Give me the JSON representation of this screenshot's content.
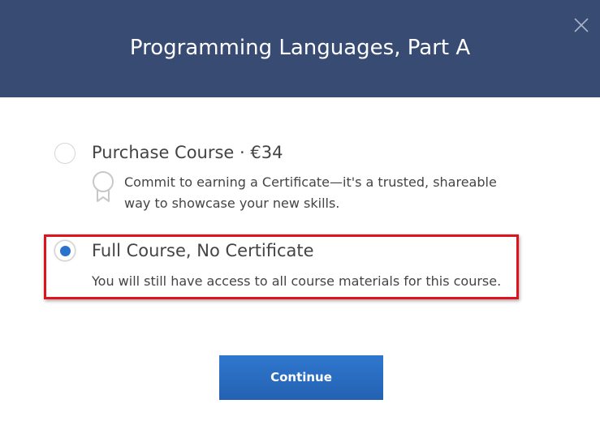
{
  "dialog": {
    "title": "Programming Languages, Part A",
    "close_icon": "close-icon"
  },
  "options": [
    {
      "title": "Purchase Course · €34",
      "description_line1": "Commit to earning a Certificate—it's a trusted, shareable",
      "description_line2": "way to showcase your new skills.",
      "icon": "certificate-ribbon-icon",
      "selected": false
    },
    {
      "title": "Full Course, No Certificate",
      "description": "You will still have access to all course materials for this course.",
      "selected": true
    }
  ],
  "actions": {
    "continue_label": "Continue"
  },
  "colors": {
    "header_bg": "#374b73",
    "accent": "#2a73cc",
    "button_bg": "#2a6bc2",
    "highlight": "#e0121b"
  }
}
